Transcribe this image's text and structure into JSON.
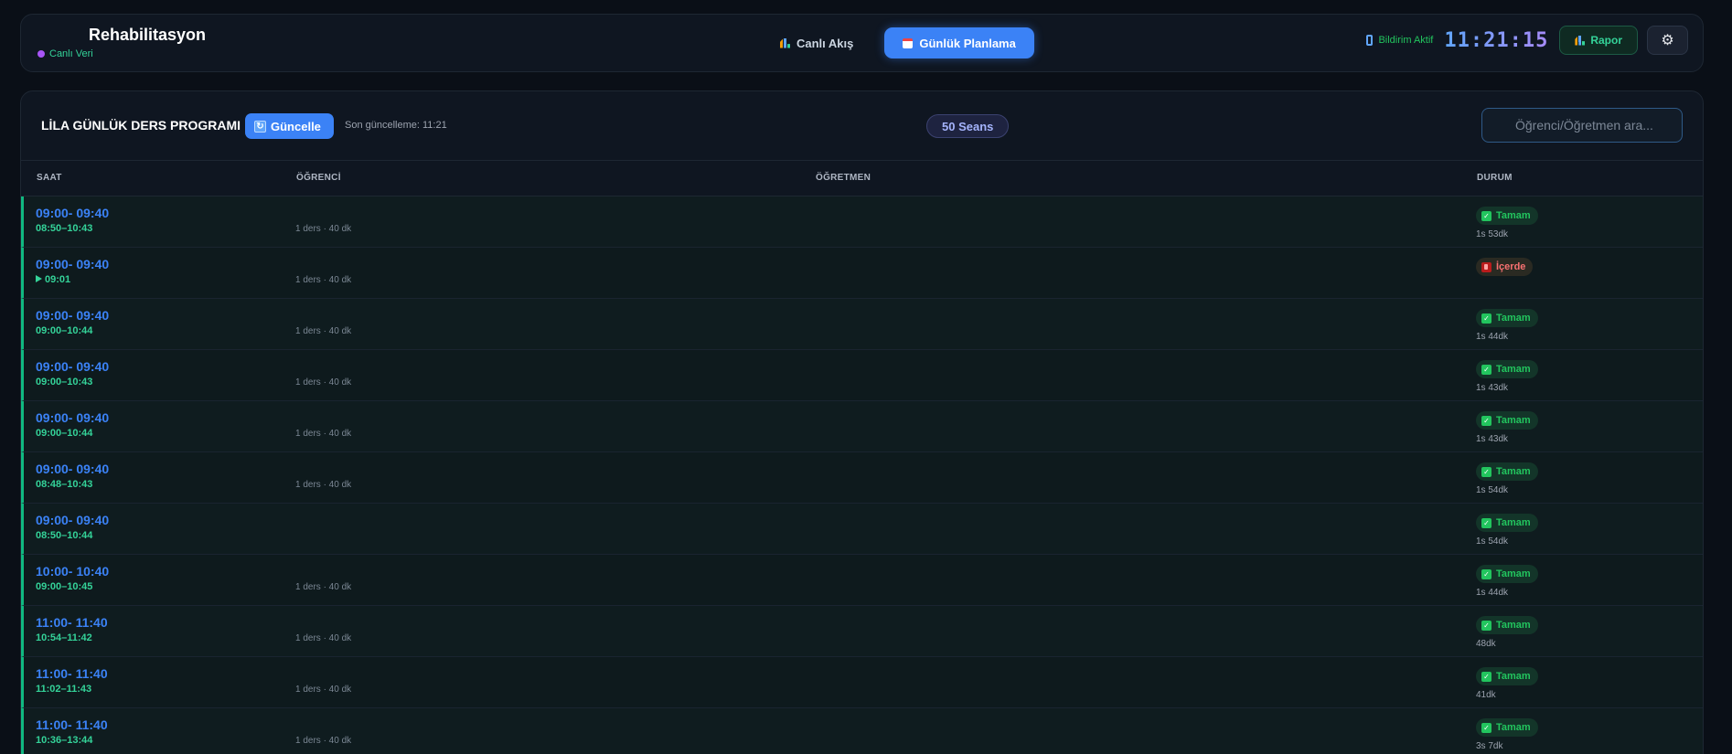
{
  "header": {
    "app_title": "Rehabilitasyon",
    "live_label": "Canlı Veri",
    "nav": [
      {
        "label": "Canlı Akış",
        "icon": "bar-chart-icon",
        "active": false
      },
      {
        "label": "Günlük Planlama",
        "icon": "calendar-icon",
        "active": true
      }
    ],
    "notification_label": "Bildirim Aktif",
    "clock": "11:21:15",
    "report_label": "Rapor",
    "settings_icon": "gear-icon"
  },
  "toolbar": {
    "title": "LİLA GÜNLÜK DERS PROGRAMI",
    "refresh_label": "Güncelle",
    "last_update": "Son güncelleme: 11:21",
    "session_count": "50 Seans",
    "search_placeholder": "Öğrenci/Öğretmen ara..."
  },
  "table": {
    "columns": [
      "SAAT",
      "ÖĞRENCİ",
      "ÖĞRETMEN",
      "DURUM"
    ],
    "rows": [
      {
        "time": "09:00- 09:40",
        "actual": "08:50–10:43",
        "lesson": "1 ders · 40 dk",
        "status": "Tamam",
        "duration": "1s 53dk",
        "live": false
      },
      {
        "time": "09:00- 09:40",
        "actual": "09:01",
        "lesson": "1 ders · 40 dk",
        "status": "İçerde",
        "duration": "",
        "live": true
      },
      {
        "time": "09:00- 09:40",
        "actual": "09:00–10:44",
        "lesson": "1 ders · 40 dk",
        "status": "Tamam",
        "duration": "1s 44dk",
        "live": false
      },
      {
        "time": "09:00- 09:40",
        "actual": "09:00–10:43",
        "lesson": "1 ders · 40 dk",
        "status": "Tamam",
        "duration": "1s 43dk",
        "live": false
      },
      {
        "time": "09:00- 09:40",
        "actual": "09:00–10:44",
        "lesson": "1 ders · 40 dk",
        "status": "Tamam",
        "duration": "1s 43dk",
        "live": false
      },
      {
        "time": "09:00- 09:40",
        "actual": "08:48–10:43",
        "lesson": "1 ders · 40 dk",
        "status": "Tamam",
        "duration": "1s 54dk",
        "live": false
      },
      {
        "time": "09:00- 09:40",
        "actual": "08:50–10:44",
        "lesson": "",
        "status": "Tamam",
        "duration": "1s 54dk",
        "live": false
      },
      {
        "time": "10:00- 10:40",
        "actual": "09:00–10:45",
        "lesson": "1 ders · 40 dk",
        "status": "Tamam",
        "duration": "1s 44dk",
        "live": false
      },
      {
        "time": "11:00- 11:40",
        "actual": "10:54–11:42",
        "lesson": "1 ders · 40 dk",
        "status": "Tamam",
        "duration": "48dk",
        "live": false
      },
      {
        "time": "11:00- 11:40",
        "actual": "11:02–11:43",
        "lesson": "1 ders · 40 dk",
        "status": "Tamam",
        "duration": "41dk",
        "live": false
      },
      {
        "time": "11:00- 11:40",
        "actual": "10:36–13:44",
        "lesson": "1 ders · 40 dk",
        "status": "Tamam",
        "duration": "3s 7dk",
        "live": false
      }
    ]
  }
}
